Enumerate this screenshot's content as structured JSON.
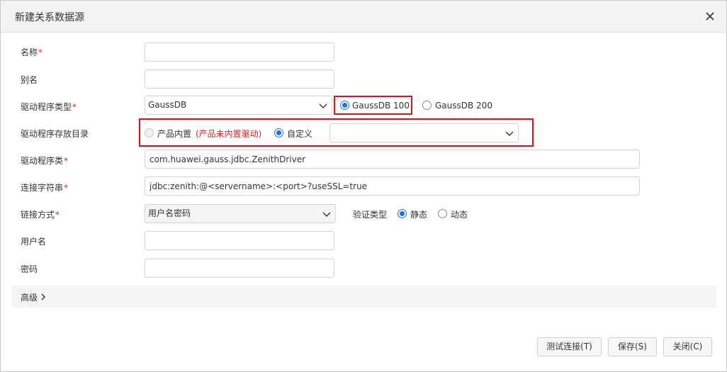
{
  "dialog": {
    "title": "新建关系数据源"
  },
  "form": {
    "name": {
      "label": "名称",
      "required": "*",
      "value": ""
    },
    "alias": {
      "label": "别名",
      "value": ""
    },
    "driver_type": {
      "label": "驱动程序类型",
      "required": "*",
      "value": "GaussDB",
      "versions": [
        {
          "label": "GaussDB 100",
          "checked": true
        },
        {
          "label": "GaussDB 200",
          "checked": false
        }
      ]
    },
    "driver_dir": {
      "label": "驱动程序存放目录",
      "option_builtin": "产品内置",
      "builtin_warning": "(产品未内置驱动)",
      "option_custom": "自定义",
      "custom_value": ""
    },
    "driver_class": {
      "label": "驱动程序类",
      "required": "*",
      "value": "com.huawei.gauss.jdbc.ZenithDriver"
    },
    "connection_string": {
      "label": "连接字符串",
      "required": "*",
      "value": "jdbc:zenith:@<servername>:<port>?useSSL=true"
    },
    "connect_method": {
      "label": "链接方式",
      "required": "*",
      "value": "用户名密码",
      "auth_type_label": "验证类型",
      "option_static": "静态",
      "option_dynamic": "动态"
    },
    "username": {
      "label": "用户名",
      "value": ""
    },
    "password": {
      "label": "密码",
      "value": ""
    }
  },
  "advanced": {
    "label": "高级"
  },
  "buttons": {
    "test": "测试连接(T)",
    "save": "保存(S)",
    "close": "关闭(C)"
  },
  "colors": {
    "accent": "#1e6fe6",
    "required": "#e02020",
    "highlight_box": "#d9121e"
  },
  "icons": {
    "close": "close-icon",
    "chevron": "chevron-down-icon",
    "advanced": "chevron-right-icon"
  }
}
